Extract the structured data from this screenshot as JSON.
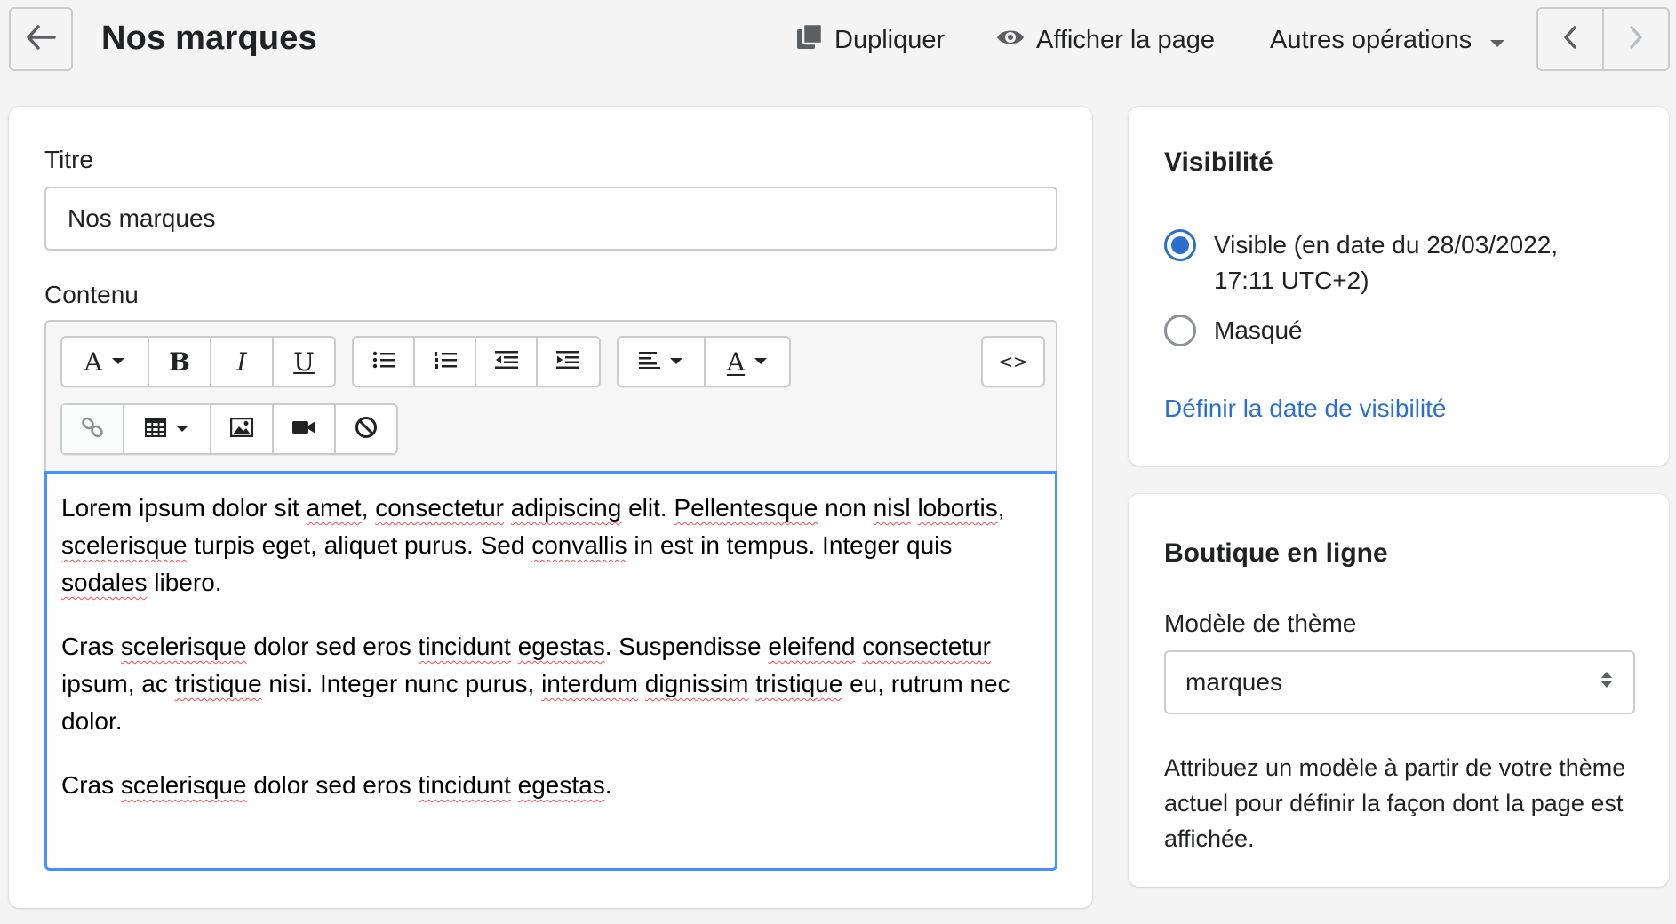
{
  "header": {
    "title": "Nos marques",
    "actions": {
      "duplicate": "Dupliquer",
      "view_page": "Afficher la page",
      "more_actions": "Autres opérations"
    }
  },
  "main_card": {
    "title_label": "Titre",
    "title_value": "Nos marques",
    "content_label": "Contenu",
    "toolbar": {
      "font_letter": "A",
      "bold": "B",
      "italic": "I",
      "underline": "U",
      "html_toggle": "<>",
      "color_letter": "A"
    },
    "paragraphs": [
      [
        {
          "t": "Lorem ipsum dolor sit ",
          "s": false
        },
        {
          "t": "amet",
          "s": true
        },
        {
          "t": ", ",
          "s": false
        },
        {
          "t": "consectetur",
          "s": true
        },
        {
          "t": " ",
          "s": false
        },
        {
          "t": "adipiscing",
          "s": true
        },
        {
          "t": " elit. ",
          "s": false
        },
        {
          "t": "Pellentesque",
          "s": true
        },
        {
          "t": " non ",
          "s": false
        },
        {
          "t": "nisl",
          "s": true
        },
        {
          "t": " ",
          "s": false
        },
        {
          "t": "lobortis",
          "s": true
        },
        {
          "t": ", ",
          "s": false
        },
        {
          "t": "scelerisque",
          "s": true
        },
        {
          "t": " turpis eget, aliquet purus. Sed ",
          "s": false
        },
        {
          "t": "convallis",
          "s": true
        },
        {
          "t": " in est in tempus. Integer quis ",
          "s": false
        },
        {
          "t": "sodales",
          "s": true
        },
        {
          "t": " libero.",
          "s": false
        }
      ],
      [
        {
          "t": "Cras ",
          "s": false
        },
        {
          "t": "scelerisque",
          "s": true
        },
        {
          "t": " dolor sed eros ",
          "s": false
        },
        {
          "t": "tincidunt",
          "s": true
        },
        {
          "t": " ",
          "s": false
        },
        {
          "t": "egestas",
          "s": true
        },
        {
          "t": ". Suspendisse ",
          "s": false
        },
        {
          "t": "eleifend",
          "s": true
        },
        {
          "t": " ",
          "s": false
        },
        {
          "t": "consectetur",
          "s": true
        },
        {
          "t": " ipsum, ac ",
          "s": false
        },
        {
          "t": "tristique",
          "s": true
        },
        {
          "t": " nisi. Integer nunc purus, ",
          "s": false
        },
        {
          "t": "interdum",
          "s": true
        },
        {
          "t": " ",
          "s": false
        },
        {
          "t": "dignissim",
          "s": true
        },
        {
          "t": " ",
          "s": false
        },
        {
          "t": "tristique",
          "s": true
        },
        {
          "t": " eu, rutrum nec dolor.",
          "s": false
        }
      ],
      [
        {
          "t": "Cras ",
          "s": false
        },
        {
          "t": "scelerisque",
          "s": true
        },
        {
          "t": " dolor sed eros ",
          "s": false
        },
        {
          "t": "tincidunt",
          "s": true
        },
        {
          "t": " ",
          "s": false
        },
        {
          "t": "egestas",
          "s": true
        },
        {
          "t": ".",
          "s": false
        }
      ]
    ]
  },
  "visibility_card": {
    "title": "Visibilité",
    "options": [
      {
        "label_line1": "Visible (en date du 28/03/2022,",
        "label_line2": "17:11 UTC+2)",
        "selected": true
      },
      {
        "label_line1": "Masqué",
        "label_line2": "",
        "selected": false
      }
    ],
    "set_date_link": "Définir la date de visibilité"
  },
  "online_store_card": {
    "title": "Boutique en ligne",
    "template_label": "Modèle de thème",
    "template_value": "marques",
    "help_text": "Attribuez un modèle à partir de votre thème actuel pour définir la façon dont la page est affichée."
  },
  "colors": {
    "accent": "#2c6ecb",
    "focus_border": "#458fff",
    "spellcheck": "#e8505b"
  }
}
